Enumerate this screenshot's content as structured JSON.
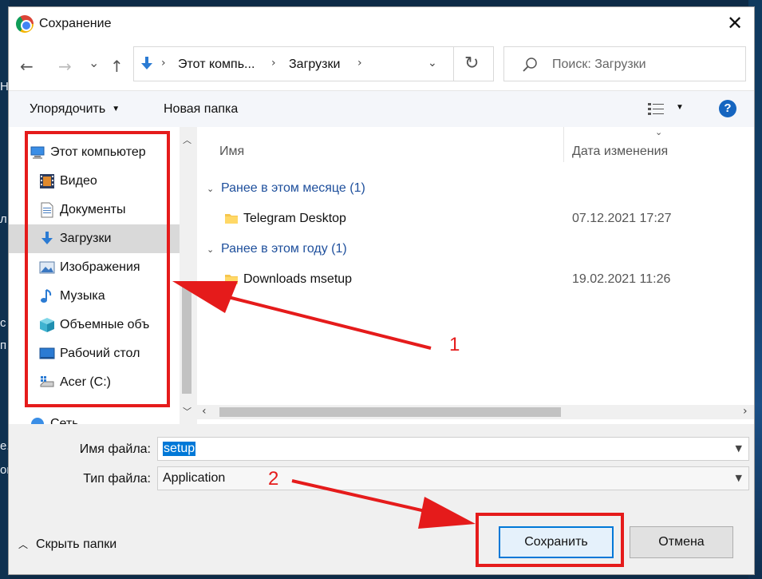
{
  "dialog": {
    "title": "Сохранение",
    "close_glyph": "✕"
  },
  "nav": {
    "back_glyph": "←",
    "forward_glyph": "→",
    "recent_glyph": "⌄",
    "up_glyph": "↑",
    "breadcrumb": [
      "Этот компь...",
      "Загрузки"
    ],
    "breadcrumb_sep": "›",
    "dropdown_glyph": "⌄",
    "refresh_glyph": "↻",
    "search_placeholder": "Поиск: Загрузки"
  },
  "toolbar": {
    "organize_label": "Упорядочить",
    "new_folder_label": "Новая папка",
    "help_label": "?"
  },
  "sidebar": {
    "items": [
      {
        "label": "Этот компьютер",
        "icon": "computer-icon"
      },
      {
        "label": "Видео",
        "icon": "video-icon"
      },
      {
        "label": "Документы",
        "icon": "documents-icon"
      },
      {
        "label": "Загрузки",
        "icon": "downloads-icon",
        "selected": true
      },
      {
        "label": "Изображения",
        "icon": "pictures-icon"
      },
      {
        "label": "Музыка",
        "icon": "music-icon"
      },
      {
        "label": "Объемные объ",
        "icon": "3d-objects-icon"
      },
      {
        "label": "Рабочий стол",
        "icon": "desktop-icon"
      },
      {
        "label": "Acer (C:)",
        "icon": "drive-icon"
      },
      {
        "label": "Сеть",
        "icon": "network-icon"
      }
    ]
  },
  "files": {
    "columns": {
      "name": "Имя",
      "date": "Дата изменения"
    },
    "groups": [
      {
        "label": "Ранее в этом месяце (1)",
        "rows": [
          {
            "name": "Telegram Desktop",
            "date": "07.12.2021 17:27"
          }
        ]
      },
      {
        "label": "Ранее в этом году (1)",
        "rows": [
          {
            "name": "Downloads msetup",
            "date": "19.02.2021 11:26"
          }
        ]
      }
    ]
  },
  "form": {
    "filename_label": "Имя файла:",
    "filename_value": "setup",
    "filetype_label": "Тип файла:",
    "filetype_value": "Application"
  },
  "footer": {
    "hide_folders_label": "Скрыть папки",
    "save_label": "Сохранить",
    "cancel_label": "Отмена"
  },
  "annotations": {
    "marker_1": "1",
    "marker_2": "2",
    "color": "#e51b1b"
  },
  "background_chars": [
    "Н",
    "с",
    "л",
    "п",
    "е.",
    "ог"
  ]
}
